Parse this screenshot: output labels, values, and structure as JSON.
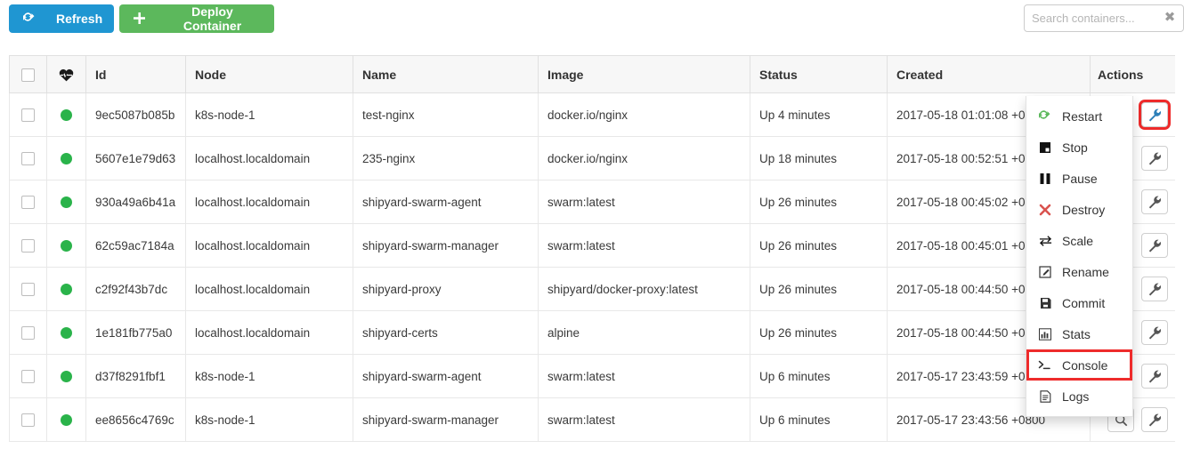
{
  "toolbar": {
    "refresh_label": "Refresh",
    "refresh_icon": "refresh-icon",
    "refresh_color": "#1f96d2",
    "deploy_label": "Deploy Container",
    "deploy_icon": "plus-icon",
    "deploy_color": "#5cb85c"
  },
  "search": {
    "placeholder": "Search containers...",
    "value": "",
    "clear_glyph": "✖"
  },
  "table": {
    "headers": {
      "checkbox": "",
      "health": "heartbeat-icon",
      "id": "Id",
      "node": "Node",
      "name": "Name",
      "image": "Image",
      "status": "Status",
      "created": "Created",
      "actions": "Actions"
    },
    "rows": [
      {
        "id": "9ec5087b085b",
        "node": "k8s-node-1",
        "name": "test-nginx",
        "image": "docker.io/nginx",
        "status": "Up 4 minutes",
        "created": "2017-05-18 01:01:08 +0800",
        "health": "healthy"
      },
      {
        "id": "5607e1e79d63",
        "node": "localhost.localdomain",
        "name": "235-nginx",
        "image": "docker.io/nginx",
        "status": "Up 18 minutes",
        "created": "2017-05-18 00:52:51 +0800",
        "health": "healthy"
      },
      {
        "id": "930a49a6b41a",
        "node": "localhost.localdomain",
        "name": "shipyard-swarm-agent",
        "image": "swarm:latest",
        "status": "Up 26 minutes",
        "created": "2017-05-18 00:45:02 +0800",
        "health": "healthy"
      },
      {
        "id": "62c59ac7184a",
        "node": "localhost.localdomain",
        "name": "shipyard-swarm-manager",
        "image": "swarm:latest",
        "status": "Up 26 minutes",
        "created": "2017-05-18 00:45:01 +0800",
        "health": "healthy"
      },
      {
        "id": "c2f92f43b7dc",
        "node": "localhost.localdomain",
        "name": "shipyard-proxy",
        "image": "shipyard/docker-proxy:latest",
        "status": "Up 26 minutes",
        "created": "2017-05-18 00:44:50 +0800",
        "health": "healthy"
      },
      {
        "id": "1e181fb775a0",
        "node": "localhost.localdomain",
        "name": "shipyard-certs",
        "image": "alpine",
        "status": "Up 26 minutes",
        "created": "2017-05-18 00:44:50 +0800",
        "health": "healthy"
      },
      {
        "id": "d37f8291fbf1",
        "node": "k8s-node-1",
        "name": "shipyard-swarm-agent",
        "image": "swarm:latest",
        "status": "Up 6 minutes",
        "created": "2017-05-17 23:43:59 +0800",
        "health": "healthy"
      },
      {
        "id": "ee8656c4769c",
        "node": "k8s-node-1",
        "name": "shipyard-swarm-manager",
        "image": "swarm:latest",
        "status": "Up 6 minutes",
        "created": "2017-05-17 23:43:56 +0800",
        "health": "healthy"
      }
    ]
  },
  "actions_menu": {
    "open_for_row": 0,
    "highlighted_item": "Console",
    "items": [
      {
        "label": "Restart",
        "icon": "restart-icon",
        "color": "#5cb85c"
      },
      {
        "label": "Stop",
        "icon": "stop-icon",
        "color": "#111111"
      },
      {
        "label": "Pause",
        "icon": "pause-icon",
        "color": "#111111"
      },
      {
        "label": "Destroy",
        "icon": "destroy-icon",
        "color": "#d9534f"
      },
      {
        "label": "Scale",
        "icon": "scale-icon",
        "color": "#111111"
      },
      {
        "label": "Rename",
        "icon": "rename-icon",
        "color": "#333333"
      },
      {
        "label": "Commit",
        "icon": "commit-icon",
        "color": "#333333"
      },
      {
        "label": "Stats",
        "icon": "stats-icon",
        "color": "#333333"
      },
      {
        "label": "Console",
        "icon": "console-icon",
        "color": "#333333"
      },
      {
        "label": "Logs",
        "icon": "logs-icon",
        "color": "#333333"
      }
    ]
  },
  "highlights": {
    "wrench_button_row": 0,
    "highlight_color": "#ee2b2b"
  }
}
